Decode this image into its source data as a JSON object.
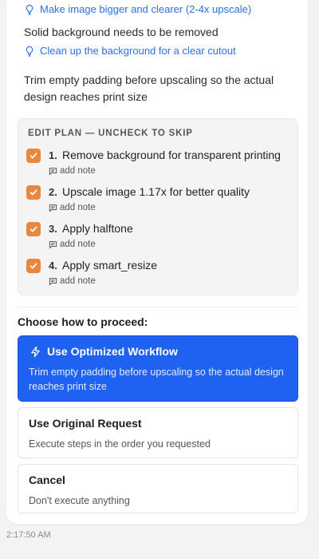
{
  "suggestions": [
    {
      "text": "Make image bigger and clearer (2-4x upscale)",
      "icon": "lightbulb-icon"
    },
    {
      "text": "Clean up the background for a clear cutout",
      "icon": "lightbulb-icon"
    }
  ],
  "issue_line": "Solid background needs to be removed",
  "explanation": "Trim empty padding before upscaling so the actual design reaches print size",
  "edit_plan": {
    "title": "EDIT PLAN — UNCHECK TO SKIP",
    "add_note_label": "add note",
    "items": [
      {
        "num": "1.",
        "text": "Remove background for transparent printing",
        "checked": true
      },
      {
        "num": "2.",
        "text": "Upscale image 1.17x for better quality",
        "checked": true
      },
      {
        "num": "3.",
        "text": "Apply halftone",
        "checked": true
      },
      {
        "num": "4.",
        "text": "Apply smart_resize",
        "checked": true
      }
    ]
  },
  "proceed_label": "Choose how to proceed:",
  "options": {
    "optimized": {
      "title": "Use Optimized Workflow",
      "desc": "Trim empty padding before upscaling so the actual design reaches print size",
      "icon": "lightning-icon"
    },
    "original": {
      "title": "Use Original Request",
      "desc": "Execute steps in the order you requested"
    },
    "cancel": {
      "title": "Cancel",
      "desc": "Don't execute anything"
    }
  },
  "timestamp": "2:17:50 AM",
  "colors": {
    "accent_blue": "#1f62f2",
    "link_blue": "#2f6fdd",
    "checkbox_orange": "#e9873f"
  }
}
